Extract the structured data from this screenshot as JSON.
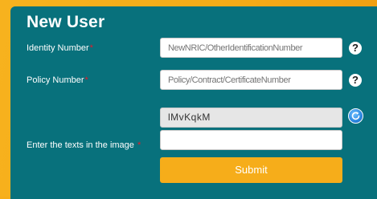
{
  "form": {
    "title": "New User",
    "identity": {
      "label": "Identity Number",
      "required_mark": "*",
      "placeholder": "NewNRIC/OtherIdentificationNumber",
      "help": "?"
    },
    "policy": {
      "label": "Policy Number",
      "required_mark": "*",
      "placeholder": "Policy/Contract/CertificateNumber",
      "help": "?"
    },
    "captcha": {
      "code": "lMvKqkM",
      "label": "Enter the texts in the image",
      "required_mark": "*",
      "value": ""
    },
    "submit_label": "Submit"
  },
  "colors": {
    "panel": "#08717c",
    "accent": "#f6ad1a",
    "required": "#e21c2a"
  },
  "icons": {
    "help": "question-circle-icon",
    "refresh": "refresh-icon"
  }
}
